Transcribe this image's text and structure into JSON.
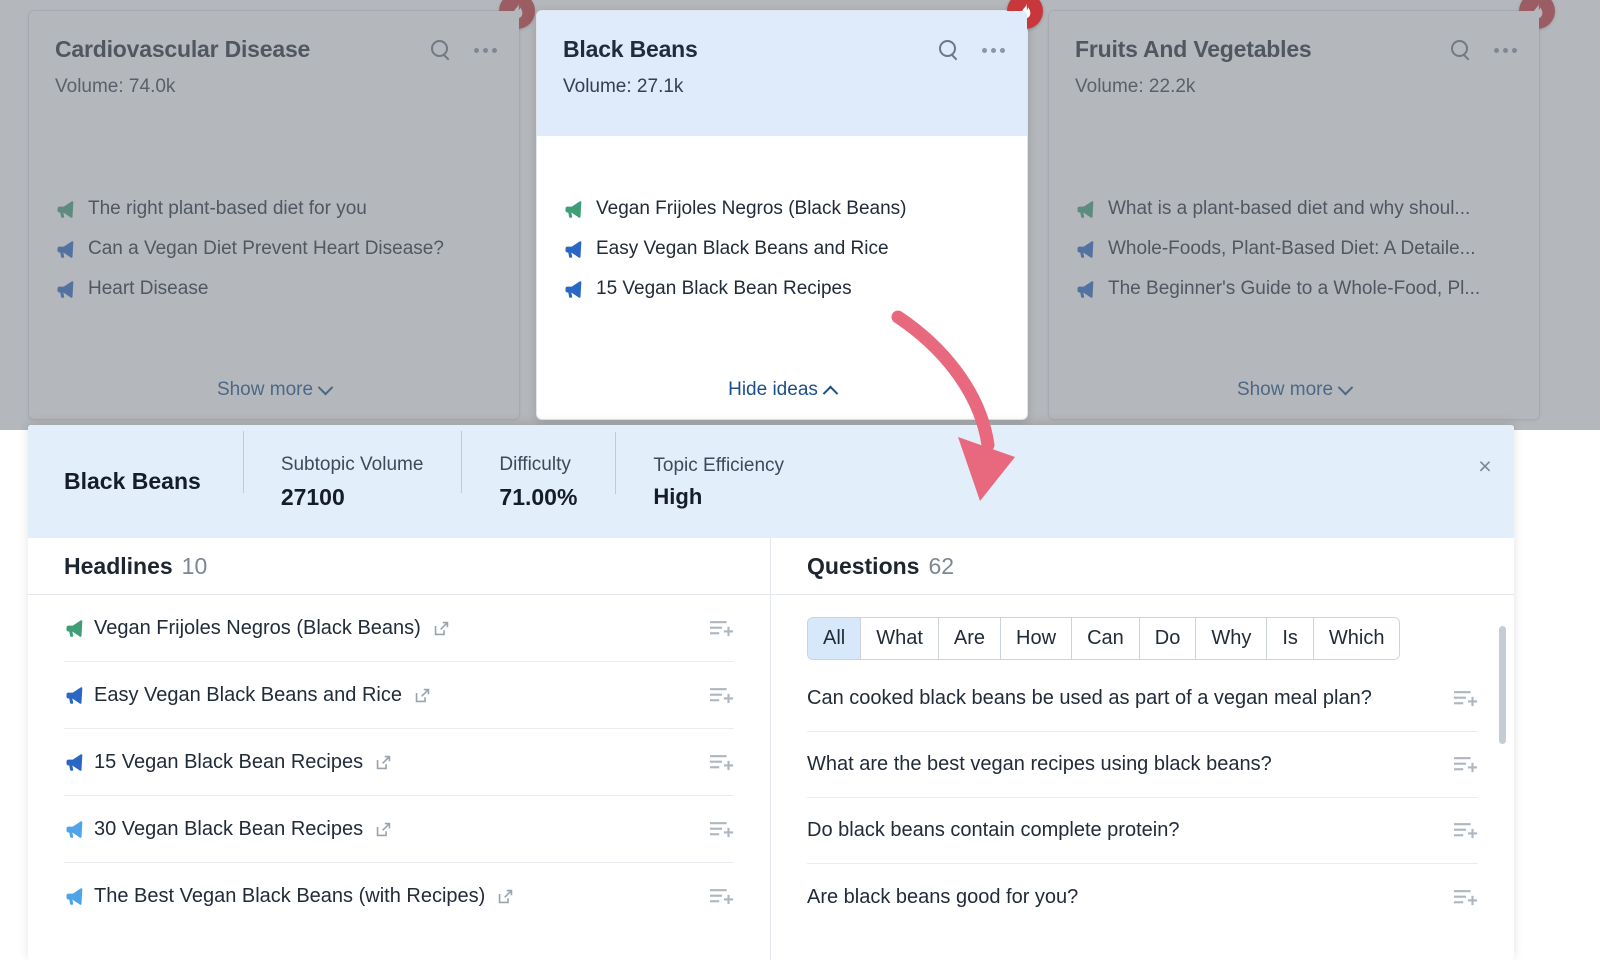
{
  "colors": {
    "accent_blue": "#1b4f8a",
    "selected_card_bg": "#dfeafb",
    "panel_head_bg": "#e2eefa",
    "flame_badge": "#c8373c",
    "arrow": "#e8697d",
    "chip_active": "#d8e8fb",
    "megaphone_green": "#3f9e78",
    "megaphone_blue": "#2a66c4",
    "megaphone_light_blue": "#4fa3e8"
  },
  "cards": [
    {
      "title": "Cardiovascular Disease",
      "volume_label": "Volume: 74.0k",
      "selected": false,
      "search_icon": "search-icon",
      "more_icon": "more-options-icon",
      "badge_icon": "flame-icon",
      "ideas": [
        {
          "text": "The right plant-based diet for you",
          "icon": "megaphone-icon",
          "icon_color": "green"
        },
        {
          "text": "Can a Vegan Diet Prevent Heart Disease?",
          "icon": "megaphone-icon",
          "icon_color": "blue"
        },
        {
          "text": "Heart Disease",
          "icon": "megaphone-icon",
          "icon_color": "blue"
        }
      ],
      "footer_label": "Show more",
      "footer_icon": "chevron-down-icon"
    },
    {
      "title": "Black Beans",
      "volume_label": "Volume: 27.1k",
      "selected": true,
      "search_icon": "search-icon",
      "more_icon": "more-options-icon",
      "badge_icon": "flame-icon",
      "ideas": [
        {
          "text": "Vegan Frijoles Negros (Black Beans)",
          "icon": "megaphone-icon",
          "icon_color": "green"
        },
        {
          "text": "Easy Vegan Black Beans and Rice",
          "icon": "megaphone-icon",
          "icon_color": "blue"
        },
        {
          "text": "15 Vegan Black Bean Recipes",
          "icon": "megaphone-icon",
          "icon_color": "blue"
        }
      ],
      "footer_label": "Hide ideas",
      "footer_icon": "chevron-up-icon"
    },
    {
      "title": "Fruits And Vegetables",
      "volume_label": "Volume: 22.2k",
      "selected": false,
      "search_icon": "search-icon",
      "more_icon": "more-options-icon",
      "badge_icon": "flame-icon",
      "ideas": [
        {
          "text": "What is a plant-based diet and why shoul...",
          "icon": "megaphone-icon",
          "icon_color": "green"
        },
        {
          "text": "Whole-Foods, Plant-Based Diet: A Detaile...",
          "icon": "megaphone-icon",
          "icon_color": "blue"
        },
        {
          "text": "The Beginner's Guide to a Whole-Food, Pl...",
          "icon": "megaphone-icon",
          "icon_color": "blue"
        }
      ],
      "footer_label": "Show more",
      "footer_icon": "chevron-down-icon"
    }
  ],
  "panel": {
    "topic_name": "Black Beans",
    "close_label": "×",
    "metrics": [
      {
        "label": "Subtopic Volume",
        "value": "27100"
      },
      {
        "label": "Difficulty",
        "value": "71.00%"
      },
      {
        "label": "Topic Efficiency",
        "value": "High"
      }
    ],
    "headlines": {
      "title": "Headlines",
      "count": "10",
      "rows": [
        {
          "text": "Vegan Frijoles Negros (Black Beans)",
          "icon_color": "green"
        },
        {
          "text": "Easy Vegan Black Beans and Rice",
          "icon_color": "blue"
        },
        {
          "text": "15 Vegan Black Bean Recipes",
          "icon_color": "blue"
        },
        {
          "text": "30 Vegan Black Bean Recipes",
          "icon_color": "lightblue"
        },
        {
          "text": "The Best Vegan Black Beans (with Recipes)",
          "icon_color": "lightblue"
        }
      ]
    },
    "questions": {
      "title": "Questions",
      "count": "62",
      "filters": [
        {
          "label": "All",
          "active": true
        },
        {
          "label": "What",
          "active": false
        },
        {
          "label": "Are",
          "active": false
        },
        {
          "label": "How",
          "active": false
        },
        {
          "label": "Can",
          "active": false
        },
        {
          "label": "Do",
          "active": false
        },
        {
          "label": "Why",
          "active": false
        },
        {
          "label": "Is",
          "active": false
        },
        {
          "label": "Which",
          "active": false
        }
      ],
      "rows": [
        {
          "text": "Can cooked black beans be used as part of a vegan meal plan?"
        },
        {
          "text": "What are the best vegan recipes using black beans?"
        },
        {
          "text": "Do black beans contain complete protein?"
        },
        {
          "text": "Are black beans good for you?"
        }
      ]
    }
  },
  "annotation": {
    "arrow_icon": "curved-arrow-annotation"
  }
}
